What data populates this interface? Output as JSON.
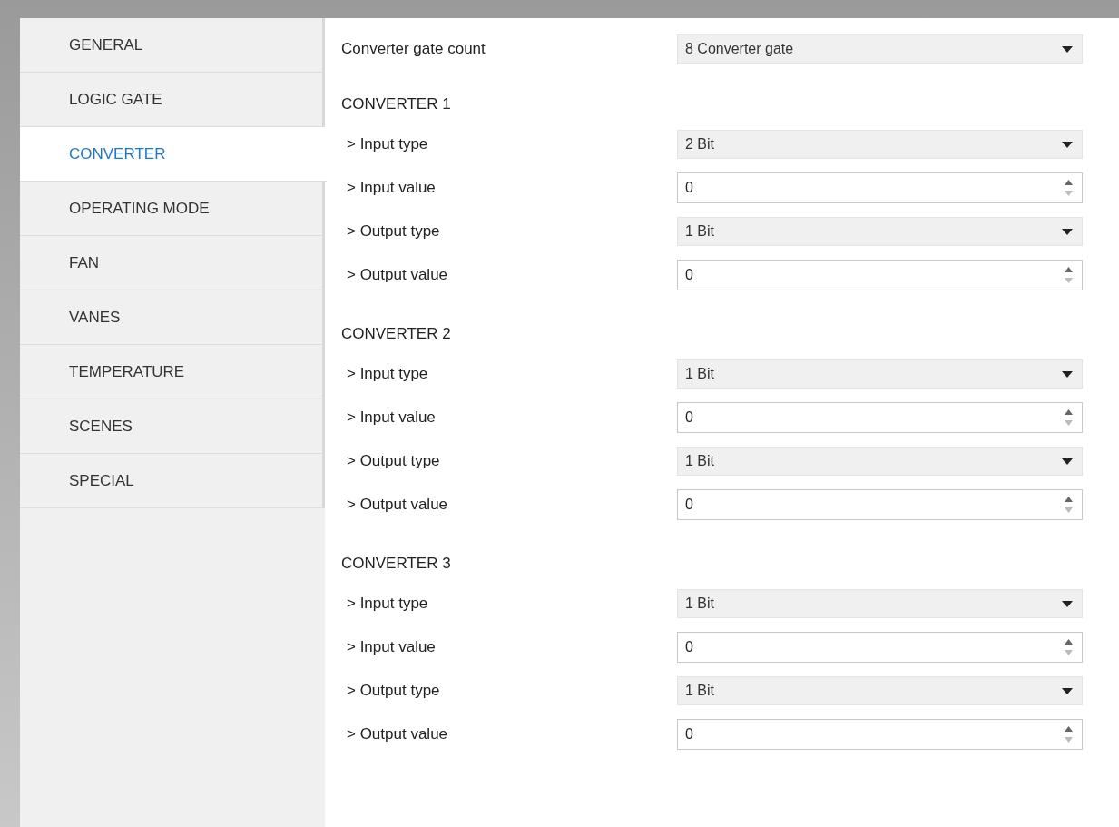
{
  "sidebar": {
    "items": [
      {
        "label": "GENERAL",
        "selected": false
      },
      {
        "label": "LOGIC GATE",
        "selected": false
      },
      {
        "label": "CONVERTER",
        "selected": true
      },
      {
        "label": "OPERATING MODE",
        "selected": false
      },
      {
        "label": "FAN",
        "selected": false
      },
      {
        "label": "VANES",
        "selected": false
      },
      {
        "label": "TEMPERATURE",
        "selected": false
      },
      {
        "label": "SCENES",
        "selected": false
      },
      {
        "label": "SPECIAL",
        "selected": false
      }
    ]
  },
  "gate_count": {
    "label": "Converter gate count",
    "value": "8 Converter gate"
  },
  "converters": [
    {
      "title": "CONVERTER 1",
      "rows": [
        {
          "kind": "select",
          "label": "> Input type",
          "value": "2 Bit"
        },
        {
          "kind": "number",
          "label": "> Input value",
          "value": "0"
        },
        {
          "kind": "select",
          "label": "> Output type",
          "value": "1 Bit"
        },
        {
          "kind": "number",
          "label": "> Output value",
          "value": "0"
        }
      ]
    },
    {
      "title": "CONVERTER 2",
      "rows": [
        {
          "kind": "select",
          "label": "> Input type",
          "value": "1 Bit"
        },
        {
          "kind": "number",
          "label": "> Input value",
          "value": "0"
        },
        {
          "kind": "select",
          "label": "> Output type",
          "value": "1 Bit"
        },
        {
          "kind": "number",
          "label": "> Output value",
          "value": "0"
        }
      ]
    },
    {
      "title": "CONVERTER 3",
      "rows": [
        {
          "kind": "select",
          "label": "> Input type",
          "value": "1 Bit"
        },
        {
          "kind": "number",
          "label": "> Input value",
          "value": "0"
        },
        {
          "kind": "select",
          "label": "> Output type",
          "value": "1 Bit"
        },
        {
          "kind": "number",
          "label": "> Output value",
          "value": "0"
        }
      ]
    }
  ]
}
